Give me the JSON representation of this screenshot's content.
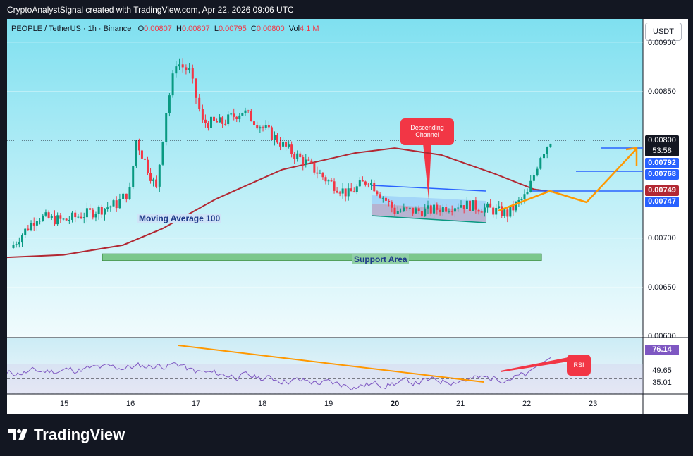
{
  "header": "CryptoAnalystSignal created with TradingView.com, Apr 22, 2026 09:06 UTC",
  "legend": {
    "symbol": "PEOPLE / TetherUS · 1h · Binance",
    "o_label": "O",
    "o": "0.00807",
    "h_label": "H",
    "h": "0.00807",
    "l_label": "L",
    "l": "0.00795",
    "c_label": "C",
    "c": "0.00800",
    "vol_label": "Vol",
    "vol": "4.1 M"
  },
  "currency": "USDT",
  "price_axis": {
    "ticks": [
      "0.00900",
      "0.00850",
      "0.00700",
      "0.00650",
      "0.00600"
    ]
  },
  "price_tags": [
    {
      "value": "0.00792",
      "color": "#2962ff"
    },
    {
      "value": "0.00768",
      "color": "#2962ff"
    },
    {
      "value": "0.00749",
      "color": "#b22833"
    },
    {
      "value": "0.00747",
      "color": "#2962ff"
    }
  ],
  "current_price": {
    "value": "0.00800",
    "countdown": "53:58"
  },
  "annotations": {
    "ma_label": "Moving Average 100",
    "support_label": "Support Area",
    "channel_label": "Descending Channel",
    "rsi_label": "RSI"
  },
  "rsi_axis": {
    "current": "76.14",
    "mid": "49.65",
    "low": "35.01"
  },
  "time_axis": [
    "15",
    "16",
    "17",
    "18",
    "19",
    "20",
    "21",
    "22",
    "23"
  ],
  "colors": {
    "up": "#089981",
    "down": "#f23645",
    "ma": "#b22833",
    "accent": "#ff9800",
    "rsi": "#7e57c2"
  },
  "brand": "TradingView",
  "chart_data": {
    "type": "candlestick",
    "symbol": "PEOPLE / TetherUS",
    "interval": "1h",
    "exchange": "Binance",
    "x_ticks": [
      "15",
      "16",
      "17",
      "18",
      "19",
      "20",
      "21",
      "22",
      "23"
    ],
    "y_ticks": [
      0.006,
      0.0065,
      0.007,
      0.0085,
      0.009
    ],
    "ylim": [
      0.006,
      0.0091
    ],
    "approx_close_path": [
      {
        "x": 14.2,
        "y": 0.0069
      },
      {
        "x": 14.6,
        "y": 0.00722
      },
      {
        "x": 15.0,
        "y": 0.00718
      },
      {
        "x": 15.4,
        "y": 0.00726
      },
      {
        "x": 15.8,
        "y": 0.00735
      },
      {
        "x": 16.0,
        "y": 0.00748
      },
      {
        "x": 16.1,
        "y": 0.008
      },
      {
        "x": 16.4,
        "y": 0.0075
      },
      {
        "x": 16.55,
        "y": 0.0083
      },
      {
        "x": 16.7,
        "y": 0.0088
      },
      {
        "x": 16.9,
        "y": 0.0087
      },
      {
        "x": 17.1,
        "y": 0.00818
      },
      {
        "x": 17.4,
        "y": 0.00818
      },
      {
        "x": 17.7,
        "y": 0.0083
      },
      {
        "x": 18.1,
        "y": 0.00808
      },
      {
        "x": 18.4,
        "y": 0.0079
      },
      {
        "x": 18.7,
        "y": 0.00775
      },
      {
        "x": 19.0,
        "y": 0.00758
      },
      {
        "x": 19.3,
        "y": 0.00745
      },
      {
        "x": 19.6,
        "y": 0.0076
      },
      {
        "x": 20.0,
        "y": 0.00728
      },
      {
        "x": 20.5,
        "y": 0.00728
      },
      {
        "x": 21.0,
        "y": 0.00735
      },
      {
        "x": 21.4,
        "y": 0.0073
      },
      {
        "x": 21.7,
        "y": 0.00725
      },
      {
        "x": 22.0,
        "y": 0.00745
      },
      {
        "x": 22.2,
        "y": 0.00785
      },
      {
        "x": 22.35,
        "y": 0.008
      }
    ],
    "ma_100_path": [
      {
        "x": 14.0,
        "y": 0.0068
      },
      {
        "x": 15.0,
        "y": 0.00683
      },
      {
        "x": 15.9,
        "y": 0.00693
      },
      {
        "x": 16.5,
        "y": 0.0071
      },
      {
        "x": 17.3,
        "y": 0.0074
      },
      {
        "x": 18.3,
        "y": 0.0077
      },
      {
        "x": 19.4,
        "y": 0.00787
      },
      {
        "x": 20.0,
        "y": 0.00792
      },
      {
        "x": 20.7,
        "y": 0.00785
      },
      {
        "x": 21.5,
        "y": 0.00766
      },
      {
        "x": 22.1,
        "y": 0.0075
      },
      {
        "x": 22.4,
        "y": 0.00747
      }
    ],
    "support_zone": [
      0.00677,
      0.00684
    ],
    "levels": [
      0.00792,
      0.00768,
      0.00749,
      0.00747
    ],
    "rsi": {
      "current": 76.14,
      "levels": [
        49.65,
        35.01
      ]
    }
  }
}
